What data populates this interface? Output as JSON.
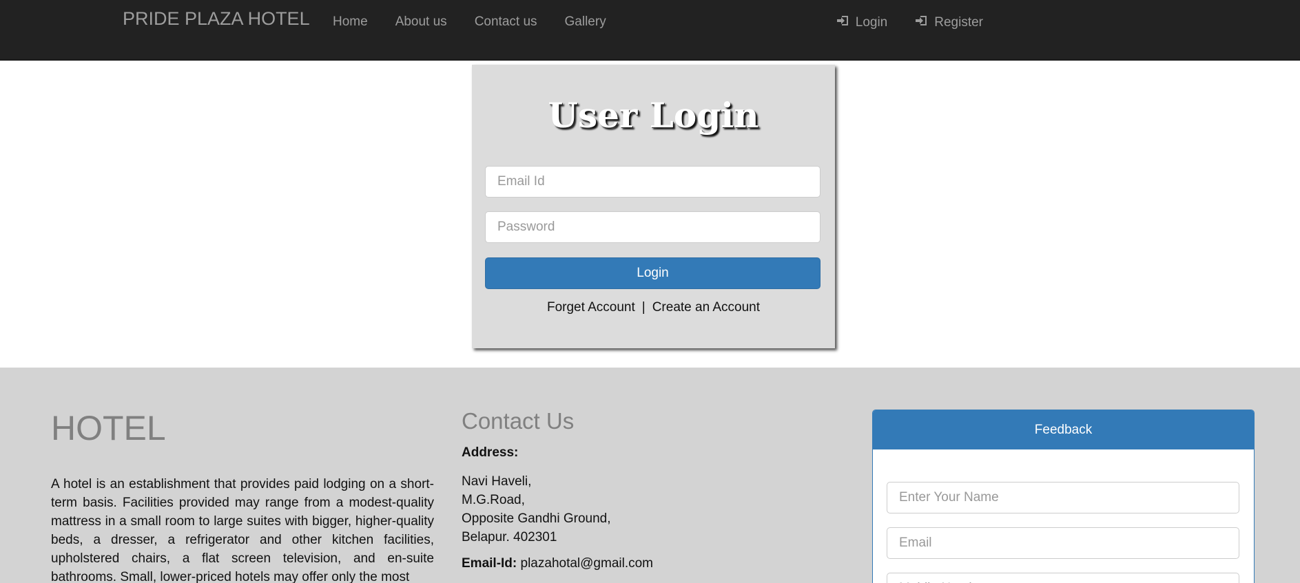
{
  "navbar": {
    "brand": "PRIDE PLAZA HOTEL",
    "links": [
      "Home",
      "About us",
      "Contact us",
      "Gallery"
    ],
    "login_label": "Login",
    "register_label": "Register",
    "login_icon": "login-icon",
    "register_icon": "login-icon"
  },
  "login_form": {
    "title": "User Login",
    "email_placeholder": "Email Id",
    "password_placeholder": "Password",
    "button_label": "Login",
    "forget_label": "Forget Account",
    "separator": "|",
    "create_label": "Create an Account"
  },
  "footer": {
    "hotel": {
      "title": "HOTEL",
      "text": "A hotel is an establishment that provides paid lodging on a short-term basis. Facilities provided may range from a modest-quality mattress in a small room to large suites with bigger, higher-quality beds, a dresser, a refrigerator and other kitchen facilities, upholstered chairs, a flat screen television, and en-suite bathrooms. Small, lower-priced hotels may offer only the most"
    },
    "contact": {
      "title": "Contact Us",
      "address_label": "Address:",
      "address_lines": [
        "Navi Haveli,",
        "M.G.Road,",
        "Opposite Gandhi Ground,",
        "Belapur. 402301"
      ],
      "email_label": "Email-Id:",
      "email_value": "plazahotal@gmail.com"
    },
    "feedback": {
      "title": "Feedback",
      "name_placeholder": "Enter Your Name",
      "email_placeholder": "Email",
      "mobile_placeholder": "Mobile Number"
    }
  },
  "colors": {
    "navbar_bg": "#222222",
    "nav_text": "#9d9d9d",
    "primary": "#337ab7",
    "card_bg": "#dcdcdc",
    "footer_bg": "#d3d3d3"
  }
}
